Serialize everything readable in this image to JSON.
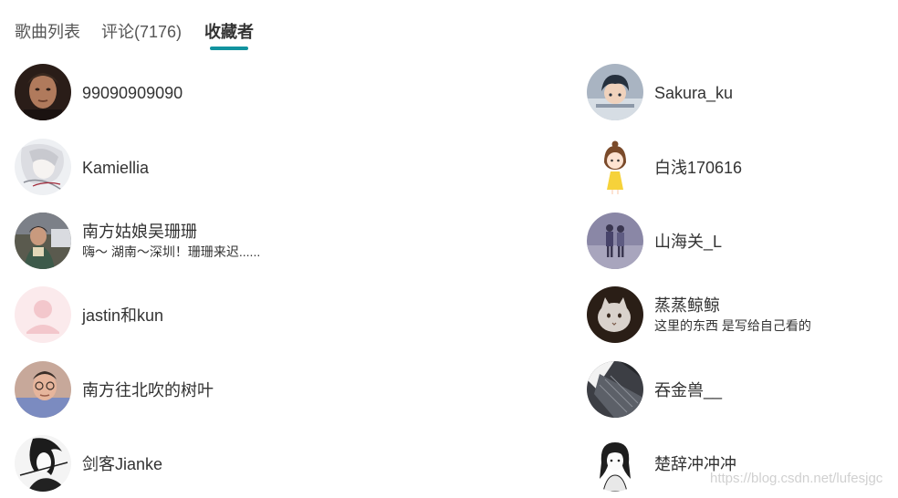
{
  "tabs": [
    {
      "label": "歌曲列表",
      "active": false
    },
    {
      "label": "评论(7176)",
      "active": false
    },
    {
      "label": "收藏者",
      "active": true
    }
  ],
  "accent_color": "#12939f",
  "users": [
    {
      "name": "99090909090",
      "signature": "",
      "avatar": "dark-portrait-avatar"
    },
    {
      "name": "Sakura_ku",
      "signature": "",
      "avatar": "anime-boy-avatar"
    },
    {
      "name": "Kamiellia",
      "signature": "",
      "avatar": "sketch-girl-avatar"
    },
    {
      "name": "白浅170616",
      "signature": "",
      "avatar": "cartoon-girl-avatar"
    },
    {
      "name": "南方姑娘吴珊珊",
      "signature": "嗨～ 湖南～深圳！珊珊来迟......",
      "avatar": "photo-girl-avatar"
    },
    {
      "name": "山海关_L",
      "signature": "",
      "avatar": "couple-walking-avatar"
    },
    {
      "name": "jastin和kun",
      "signature": "",
      "avatar": "default-user-avatar"
    },
    {
      "name": "蒸蒸鲸鲸",
      "signature": "这里的东西 是写给自己看的",
      "avatar": "cat-avatar"
    },
    {
      "name": "南方往北吹的树叶",
      "signature": "",
      "avatar": "glasses-boy-avatar"
    },
    {
      "name": "吞金兽__",
      "signature": "",
      "avatar": "fabric-avatar"
    },
    {
      "name": "剑客Jianke",
      "signature": "",
      "avatar": "manga-swordsman-avatar"
    },
    {
      "name": "楚辞冲冲冲",
      "signature": "",
      "avatar": "manga-girl-avatar"
    }
  ],
  "watermark": "https://blog.csdn.net/lufesjgc"
}
